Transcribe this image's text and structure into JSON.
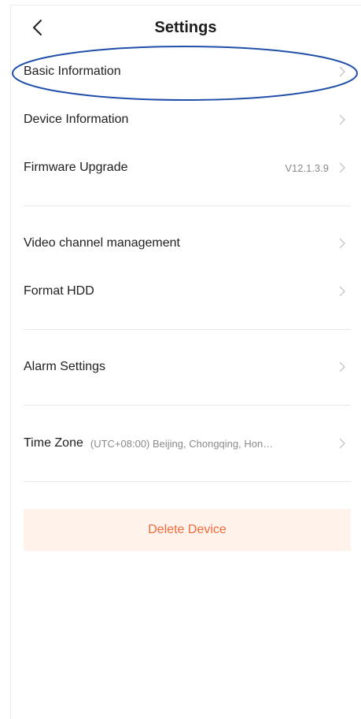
{
  "header": {
    "title": "Settings"
  },
  "rows": {
    "basic_information": {
      "label": "Basic Information"
    },
    "device_information": {
      "label": "Device Information"
    },
    "firmware_upgrade": {
      "label": "Firmware Upgrade",
      "value": "V12.1.3.9"
    },
    "video_channel_management": {
      "label": "Video channel management"
    },
    "format_hdd": {
      "label": "Format HDD"
    },
    "alarm_settings": {
      "label": "Alarm Settings"
    },
    "time_zone": {
      "label": "Time Zone",
      "value": "(UTC+08:00) Beijing, Chongqing, Hon…"
    }
  },
  "actions": {
    "delete_device": "Delete Device"
  },
  "icons": {
    "back": "chevron-left-icon",
    "row_arrow": "chevron-right-icon"
  },
  "colors": {
    "accent_delete_text": "#f26a3a",
    "delete_background": "#fff3ec",
    "annotation_ellipse": "#1f4fa8"
  }
}
